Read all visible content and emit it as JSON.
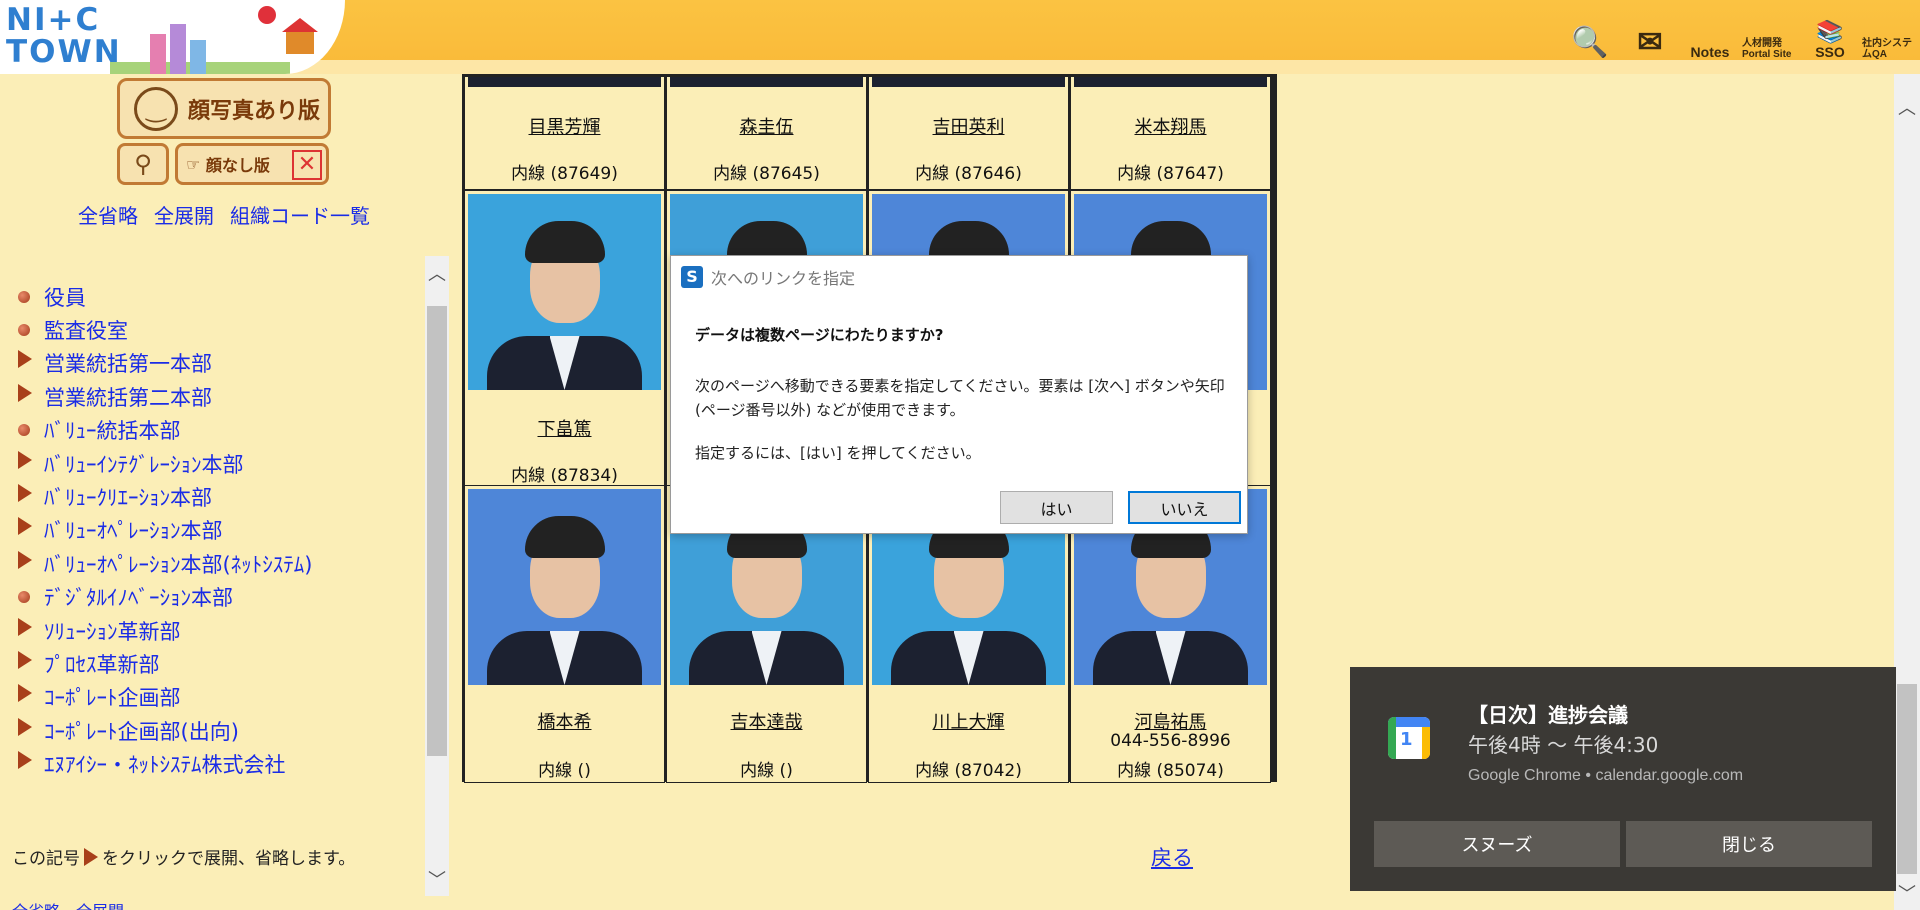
{
  "header": {
    "logo_text": "NI+C\nTOWN",
    "icons": [
      {
        "name": "search-person-icon",
        "glyph": "🔍",
        "label": ""
      },
      {
        "name": "mail-icon",
        "glyph": "✉",
        "label": ""
      },
      {
        "name": "notes-icon",
        "glyph": "",
        "label": "Notes"
      },
      {
        "name": "portal-site-icon",
        "glyph": "",
        "label": "人材開発 Portal Site"
      },
      {
        "name": "sso-icon",
        "glyph": "📚",
        "label": "SSO"
      },
      {
        "name": "internal-system-qa-icon",
        "glyph": "",
        "label": "社内システムQA"
      }
    ]
  },
  "sidebar": {
    "photo_version_label": "顔写真あり版",
    "no_face_label": "顔なし版",
    "links": [
      "全省略",
      "全展開",
      "組織コード一覧"
    ],
    "tree": [
      {
        "label": "役員",
        "marker": "bullet"
      },
      {
        "label": "監査役室",
        "marker": "bullet"
      },
      {
        "label": "営業統括第一本部",
        "marker": "triangle"
      },
      {
        "label": "営業統括第二本部",
        "marker": "triangle"
      },
      {
        "label": "ﾊﾞﾘｭｰ統括本部",
        "marker": "bullet"
      },
      {
        "label": "ﾊﾞﾘｭｰｲﾝﾃｸﾞﾚｰｼｮﾝ本部",
        "marker": "triangle"
      },
      {
        "label": "ﾊﾞﾘｭｰｸﾘｴｰｼｮﾝ本部",
        "marker": "triangle"
      },
      {
        "label": "ﾊﾞﾘｭｰｵﾍﾟﾚｰｼｮﾝ本部",
        "marker": "triangle"
      },
      {
        "label": "ﾊﾞﾘｭｰｵﾍﾟﾚｰｼｮﾝ本部(ﾈｯﾄｼｽﾃﾑ)",
        "marker": "triangle"
      },
      {
        "label": "ﾃﾞｼﾞﾀﾙｲﾉﾍﾞｰｼｮﾝ本部",
        "marker": "bullet"
      },
      {
        "label": "ｿﾘｭｰｼｮﾝ革新部",
        "marker": "triangle"
      },
      {
        "label": "ﾌﾟﾛｾｽ革新部",
        "marker": "triangle"
      },
      {
        "label": "ｺｰﾎﾟﾚｰﾄ企画部",
        "marker": "triangle"
      },
      {
        "label": "ｺｰﾎﾟﾚｰﾄ企画部(出向)",
        "marker": "triangle"
      },
      {
        "label": "ｴﾇｱｲｼｰ・ﾈｯﾄｼｽﾃﾑ株式会社",
        "marker": "triangle"
      }
    ],
    "note_prefix": "この記号",
    "note_suffix": "をクリックで展開、省略します。",
    "bottom_cut": "全省略　全展開"
  },
  "people": [
    {
      "name": "目黒芳輝",
      "tel": "",
      "ext": "内線 (87649)"
    },
    {
      "name": "森圭伍",
      "tel": "",
      "ext": "内線 (87645)"
    },
    {
      "name": "吉田英利",
      "tel": "",
      "ext": "内線 (87646)"
    },
    {
      "name": "米本翔馬",
      "tel": "",
      "ext": "内線 (87647)"
    },
    {
      "name": "下畠篤",
      "tel": "",
      "ext": "内線 (87834)"
    },
    {
      "name": "",
      "tel": "",
      "ext": ""
    },
    {
      "name": "",
      "tel": "",
      "ext": ""
    },
    {
      "name": "",
      "tel": "",
      "ext": ""
    },
    {
      "name": "橋本希",
      "tel": "",
      "ext": "内線 ()"
    },
    {
      "name": "吉本達哉",
      "tel": "",
      "ext": "内線 ()"
    },
    {
      "name": "川上大輝",
      "tel": "",
      "ext": "内線 (87042)"
    },
    {
      "name": "河島祐馬",
      "tel": "044-556-8996",
      "ext": "内線 (85074)"
    }
  ],
  "back_link": "戻る",
  "dialog": {
    "logo": "S",
    "title": "次へのリンクを指定",
    "heading": "データは複数ページにわたりますか?",
    "body": "次のページへ移動できる要素を指定してください。要素は [次へ] ボタンや矢印 (ページ番号以外) などが使用できます。",
    "hint": "指定するには、[はい] を押してください。",
    "yes": "はい",
    "no": "いいえ"
  },
  "toast": {
    "icon_num": "1",
    "title": "【日次】進捗会議",
    "time": "午後4時 〜 午後4:30",
    "source": "Google Chrome • calendar.google.com",
    "snooze": "スヌーズ",
    "close": "閉じる"
  },
  "colors": {
    "link": "#1a2ce6",
    "background": "#fbeeb7",
    "header": "#fbc342",
    "toast_bg": "#3b3935"
  }
}
